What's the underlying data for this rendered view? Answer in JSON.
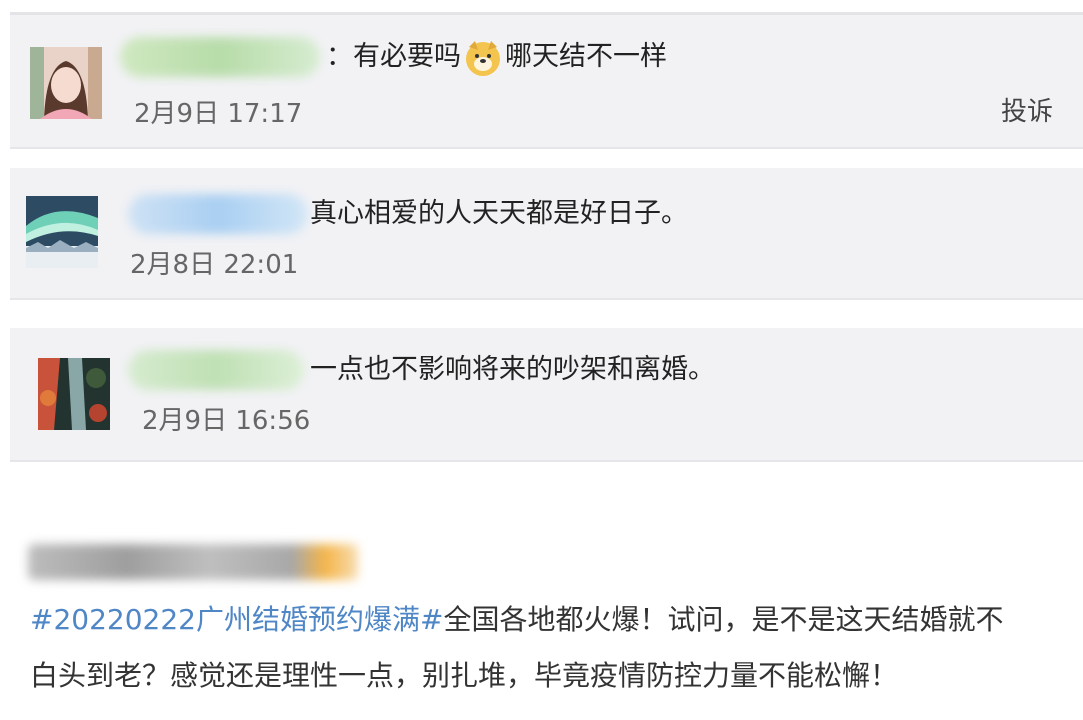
{
  "comments": [
    {
      "text_before": "：有必要吗",
      "emoji": "doge-emoji",
      "text_after": "哪天结不一样",
      "time": "2月9日 17:17",
      "report_label": "投诉"
    },
    {
      "text": "真心相爱的人天天都是好日子。",
      "time": "2月8日 22:01"
    },
    {
      "text": "一点也不影响将来的吵架和离婚。",
      "time": "2月9日 16:56"
    }
  ],
  "post": {
    "hashtag": "#20220222广州结婚预约爆满#",
    "line1_rest": "全国各地都火爆！试问，是不是这天结婚就不",
    "line2": "白头到老？感觉还是理性一点，别扎堆，毕竟疫情防控力量不能松懈！"
  },
  "colors": {
    "card_bg": "#f2f2f5",
    "hashtag": "#4f86c6"
  }
}
